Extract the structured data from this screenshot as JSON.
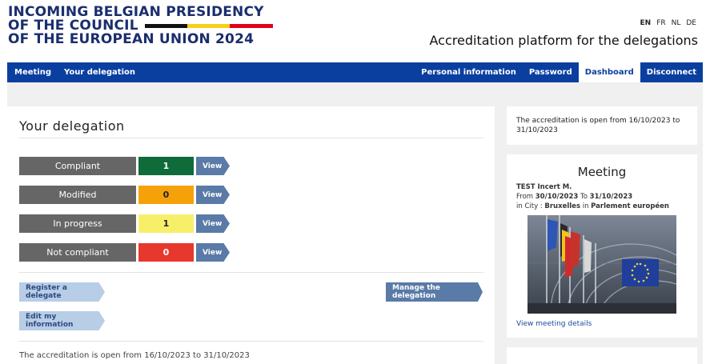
{
  "header": {
    "logo_lines": [
      "INCOMING BELGIAN PRESIDENCY",
      "OF THE COUNCIL",
      "OF THE EUROPEAN UNION 2024"
    ],
    "languages": [
      "EN",
      "FR",
      "NL",
      "DE"
    ],
    "active_language": "EN",
    "platform_title": "Accreditation platform for the delegations",
    "flag_colors": [
      "#111111",
      "#f7d117",
      "#e2001a"
    ]
  },
  "nav": {
    "left": [
      "Meeting",
      "Your delegation"
    ],
    "right": [
      "Personal information",
      "Password",
      "Dashboard",
      "Disconnect"
    ],
    "active": "Dashboard",
    "color": "#0a3fa0"
  },
  "delegation": {
    "title": "Your delegation",
    "statuses": [
      {
        "label": "Compliant",
        "count": "1",
        "color": "#0f6b3a",
        "text_color": "#ffffff",
        "view": "View"
      },
      {
        "label": "Modified",
        "count": "0",
        "color": "#f5a10a",
        "text_color": "#222222",
        "view": "View"
      },
      {
        "label": "In progress",
        "count": "1",
        "color": "#f7ef6a",
        "text_color": "#222222",
        "view": "View"
      },
      {
        "label": "Not compliant",
        "count": "0",
        "color": "#e8372c",
        "text_color": "#ffffff",
        "view": "View"
      }
    ],
    "register_label": "Register a delegate",
    "manage_label": "Manage the delegation",
    "edit_label": "Edit my information",
    "accreditation_note": "The accreditation is open from 16/10/2023 to 31/10/2023"
  },
  "sidebar": {
    "accreditation_note": "The accreditation is open from 16/10/2023 to 31/10/2023",
    "meeting": {
      "title": "Meeting",
      "name": "TEST Incert M.",
      "from_label": "From",
      "from_date": "30/10/2023",
      "to_label": "To",
      "to_date": "31/10/2023",
      "in_label": "in",
      "city_label": "City :",
      "city": "Bruxelles",
      "in2_label": "in",
      "venue": "Parlement européen",
      "link": "View meeting details"
    }
  }
}
